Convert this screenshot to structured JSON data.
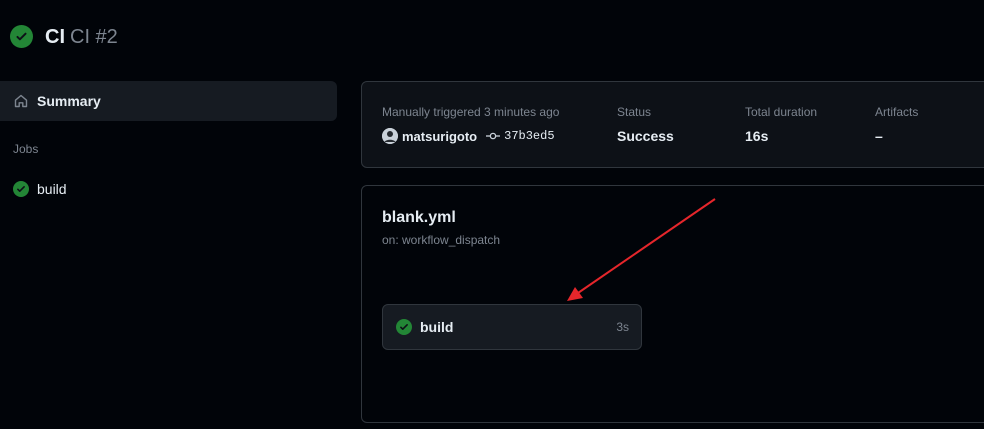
{
  "header": {
    "workflow_name": "CI",
    "run_name": "CI #2",
    "status_icon": "check-circle-icon",
    "status_color": "#238636"
  },
  "sidebar": {
    "summary_label": "Summary",
    "summary_icon": "home-icon",
    "jobs_heading": "Jobs",
    "jobs": [
      {
        "label": "build",
        "status_icon": "check-circle-icon"
      }
    ]
  },
  "summary_card": {
    "trigger_text": "Manually triggered 3 minutes ago",
    "actor": "matsurigoto",
    "commit_icon": "git-commit-icon",
    "commit_sha": "37b3ed5",
    "status_label": "Status",
    "status_value": "Success",
    "duration_label": "Total duration",
    "duration_value": "16s",
    "artifacts_label": "Artifacts",
    "artifacts_value": "–"
  },
  "graph": {
    "file_name": "blank.yml",
    "trigger": "on: workflow_dispatch",
    "jobs": [
      {
        "name": "build",
        "duration": "3s",
        "status_icon": "check-circle-icon"
      }
    ]
  },
  "annotation": {
    "arrow_color": "#e5262b"
  }
}
